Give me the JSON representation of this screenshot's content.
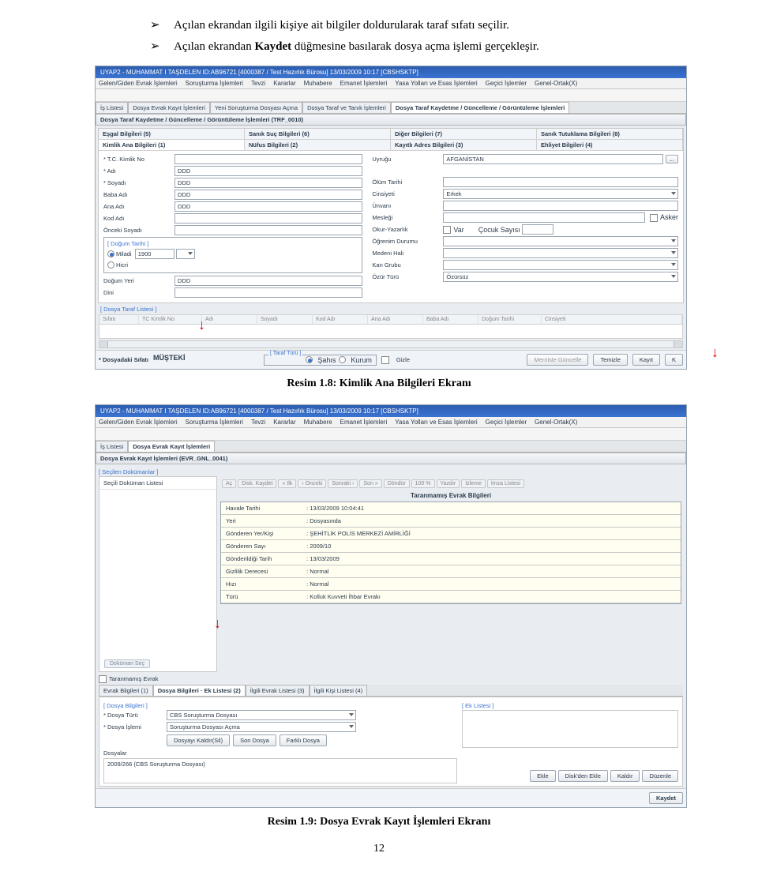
{
  "bullets": {
    "b1a": "Açılan ekrandan ilgili kişiye ait bilgiler doldurularak taraf sıfatı seçilir.",
    "b2a": "Açılan ekrandan ",
    "b2b": "Kaydet",
    "b2c": " düğmesine basılarak dosya açma işlemi gerçekleşir."
  },
  "caption1": "Resim 1.8: Kimlik Ana Bilgileri Ekranı",
  "caption2": "Resim 1.9: Dosya Evrak Kayıt İşlemleri Ekranı",
  "page_num": "12",
  "s1": {
    "title": "UYAP2 - MUHAMMAT I TAŞDELEN  ID:AB96721  [4000387 / Test Hazırlık Bürosu]  13/03/2009 10:17 [CBSHSKTP]",
    "menus": [
      "Gelen/Giden Evrak İşlemleri",
      "Soruşturma İşlemleri",
      "Tevzi",
      "Kararlar",
      "Muhabere",
      "Emanet İşlemleri",
      "Yasa Yolları ve Esas İşlemleri",
      "Geçici İşlemler",
      "Genel-Ortak(X)"
    ],
    "tabs_top": [
      "İş Listesi",
      "Dosya Evrak Kayıt İşlemleri",
      "Yeni Soruşturma Dosyası Açma",
      "Dosya Taraf ve Tanık İşlemleri",
      "Dosya Taraf Kaydetme / Güncelleme / Görüntüleme İşlemleri"
    ],
    "section": "Dosya Taraf Kaydetme / Güncelleme / Görüntüleme İşlemleri (TRF_0010)",
    "hdr_top": [
      "Eşgal Bilgileri (5)",
      "Sanık Suç Bilgileri (6)",
      "Diğer Bilgileri (7)",
      "Sanık Tutuklama Bilgileri (8)"
    ],
    "hdr_sub": [
      "Kimlik Ana Bilgileri (1)",
      "Nüfus Bilgileri (2)",
      "Kayıtlı Adres Bilgileri (3)",
      "Ehliyet Bilgileri (4)"
    ],
    "labels": {
      "tc": "T.C. Kimlik No",
      "adi": "Adı",
      "soyadi": "Soyadı",
      "baba": "Baba Adı",
      "ana": "Ana Adı",
      "kod": "Kod Adı",
      "onceki": "Önceki Soyadı",
      "dob_legend": "[ Doğum Tarihi ]",
      "miladi": "Miladi",
      "hicri": "Hicri",
      "dogum_yeri": "Doğum Yeri",
      "dini": "Dini",
      "uyrugu": "Uyruğu",
      "olum": "Ölüm Tarihi",
      "cinsiyet": "Cinsiyeti",
      "unvan": "Ünvanı",
      "meslek": "Mesleği",
      "okur": "Okur-Yazarlık",
      "var": "Var",
      "cocuk": "Çocuk Sayısı",
      "ogrenim": "Öğrenim Durumu",
      "medeni": "Medeni Hali",
      "kan": "Kan Grubu",
      "ozur": "Özür Türü",
      "asker": "Asker"
    },
    "values": {
      "adi": "DDD",
      "soyadi": "DDD",
      "baba": "DDD",
      "ana": "DDD",
      "dogum_yeri": "DDD",
      "miladi_year": "1900",
      "uyrugu": "AFGANİSTAN",
      "cinsiyet": "Erkek",
      "ozur": "Özürsüz"
    },
    "list_legend": "[ Dosya Taraf Listesi ]",
    "list_cols": [
      "Sıfatı",
      "TC Kimlik No",
      "Adı",
      "Soyadı",
      "Kod Adı",
      "Ana Adı",
      "Baba Adı",
      "Doğum Tarihi",
      "Cinsiyeti"
    ],
    "bottom": {
      "sifat_lbl": "* Dosyadaki Sıfatı",
      "sifat_val": "MÜŞTEKİ",
      "taraf_legend": "[ Taraf Türü ]",
      "sahis": "Şahıs",
      "kurum": "Kurum",
      "gizle": "Gizle",
      "btns": [
        "Mernisle Güncelle",
        "Temizle",
        "Kayıt",
        "K"
      ]
    }
  },
  "s2": {
    "title": "UYAP2 - MUHAMMAT I TAŞDELEN  ID:AB96721  [4000387 / Test Hazırlık Bürosu]  13/03/2009 10:17 [CBSHSKTP]",
    "tabs_top": [
      "İş Listesi",
      "Dosya Evrak Kayıt İşlemleri"
    ],
    "section": "Dosya Evrak Kayıt İşlemleri (EVR_GNL_0041)",
    "sec_legend": "[ Seçilen Dokümanlar ]",
    "left_title": "Seçili Doküman Listesi",
    "dokuman_btn": "Doküman Seç",
    "nav": [
      "Aç",
      "Disk. Kaydet",
      "« İlk",
      "‹ Önceki",
      "Sonraki ›",
      "Son »",
      "Döndür",
      "100 %",
      "Yazdır",
      "İzleme",
      "İmza Listesi"
    ],
    "info_hdr": "Taranmamış Evrak Bilgileri",
    "info_rows": [
      [
        "Havale Tarihi",
        "13/03/2009 10:04:41"
      ],
      [
        "Yeri",
        "Dosyasında"
      ],
      [
        "Gönderen Yer/Kişi",
        "ŞEHİTLİK POLİS MERKEZİ AMİRLİĞİ"
      ],
      [
        "Gönderen Sayı",
        "2009/10"
      ],
      [
        "Gönderildiği Tarih",
        "13/03/2009"
      ],
      [
        "Gizlilik Derecesi",
        "Normal"
      ],
      [
        "Hızı",
        "Normal"
      ],
      [
        "Türü",
        "Kolluk Kuvveti İhbar Evrakı"
      ]
    ],
    "taranmamis": "Taranmamış Evrak",
    "lower_tabs": [
      "Evrak Bilgileri (1)",
      "Dosya Bilgileri · Ek Listesi (2)",
      "İlgili Evrak Listesi (3)",
      "İlgili Kişi Listesi (4)"
    ],
    "dosya_legend": "[ Dosya Bilgileri ]",
    "ek_legend": "[ Ek Listesi ]",
    "rows": {
      "turu_lbl": "* Dosya Türü",
      "turu_val": "CBS Soruşturma Dosyası",
      "islem_lbl": "* Dosya İşlemi",
      "islem_val": "Soruşturma Dosyası Açma"
    },
    "midbtns": [
      "Dosyayı Kaldır(Sil)",
      "Son Dosya",
      "Farklı Dosya"
    ],
    "dosyalar_label": "Dosyalar",
    "dosyalar_text": "2009/266 (CBS Soruşturma Dosyası)",
    "right_btns": [
      "Ekle",
      "Disk'den Ekle",
      "Kaldır",
      "Düzenle"
    ],
    "kaydet": "Kaydet"
  }
}
